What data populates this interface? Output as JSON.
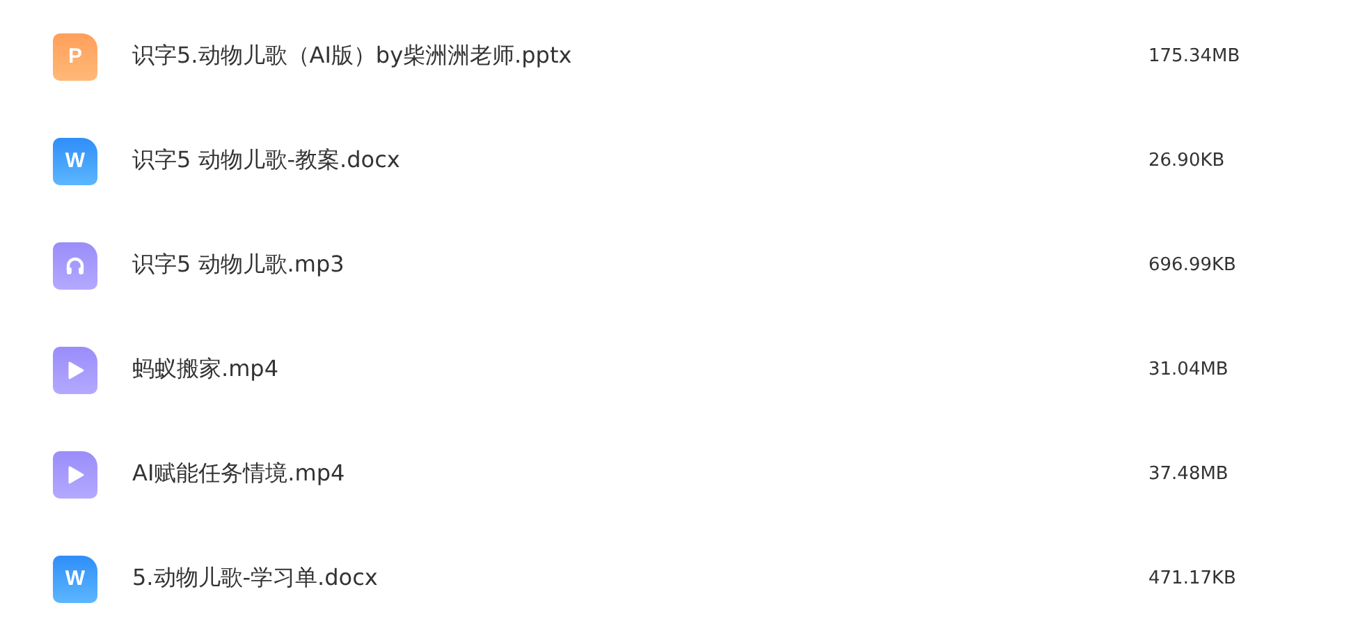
{
  "files": [
    {
      "kind": "pptx",
      "icon_text": "P",
      "name": "识字5.动物儿歌（AI版）by柴洲洲老师.pptx",
      "size": "175.34MB"
    },
    {
      "kind": "docx",
      "icon_text": "W",
      "name": "识字5 动物儿歌-教案.docx",
      "size": "26.90KB"
    },
    {
      "kind": "audio",
      "name": "识字5 动物儿歌.mp3",
      "size": "696.99KB"
    },
    {
      "kind": "video",
      "name": "蚂蚁搬家.mp4",
      "size": "31.04MB"
    },
    {
      "kind": "video",
      "name": "AI赋能任务情境.mp4",
      "size": "37.48MB"
    },
    {
      "kind": "docx",
      "icon_text": "W",
      "name": "5.动物儿歌-学习单.docx",
      "size": "471.17KB"
    }
  ]
}
